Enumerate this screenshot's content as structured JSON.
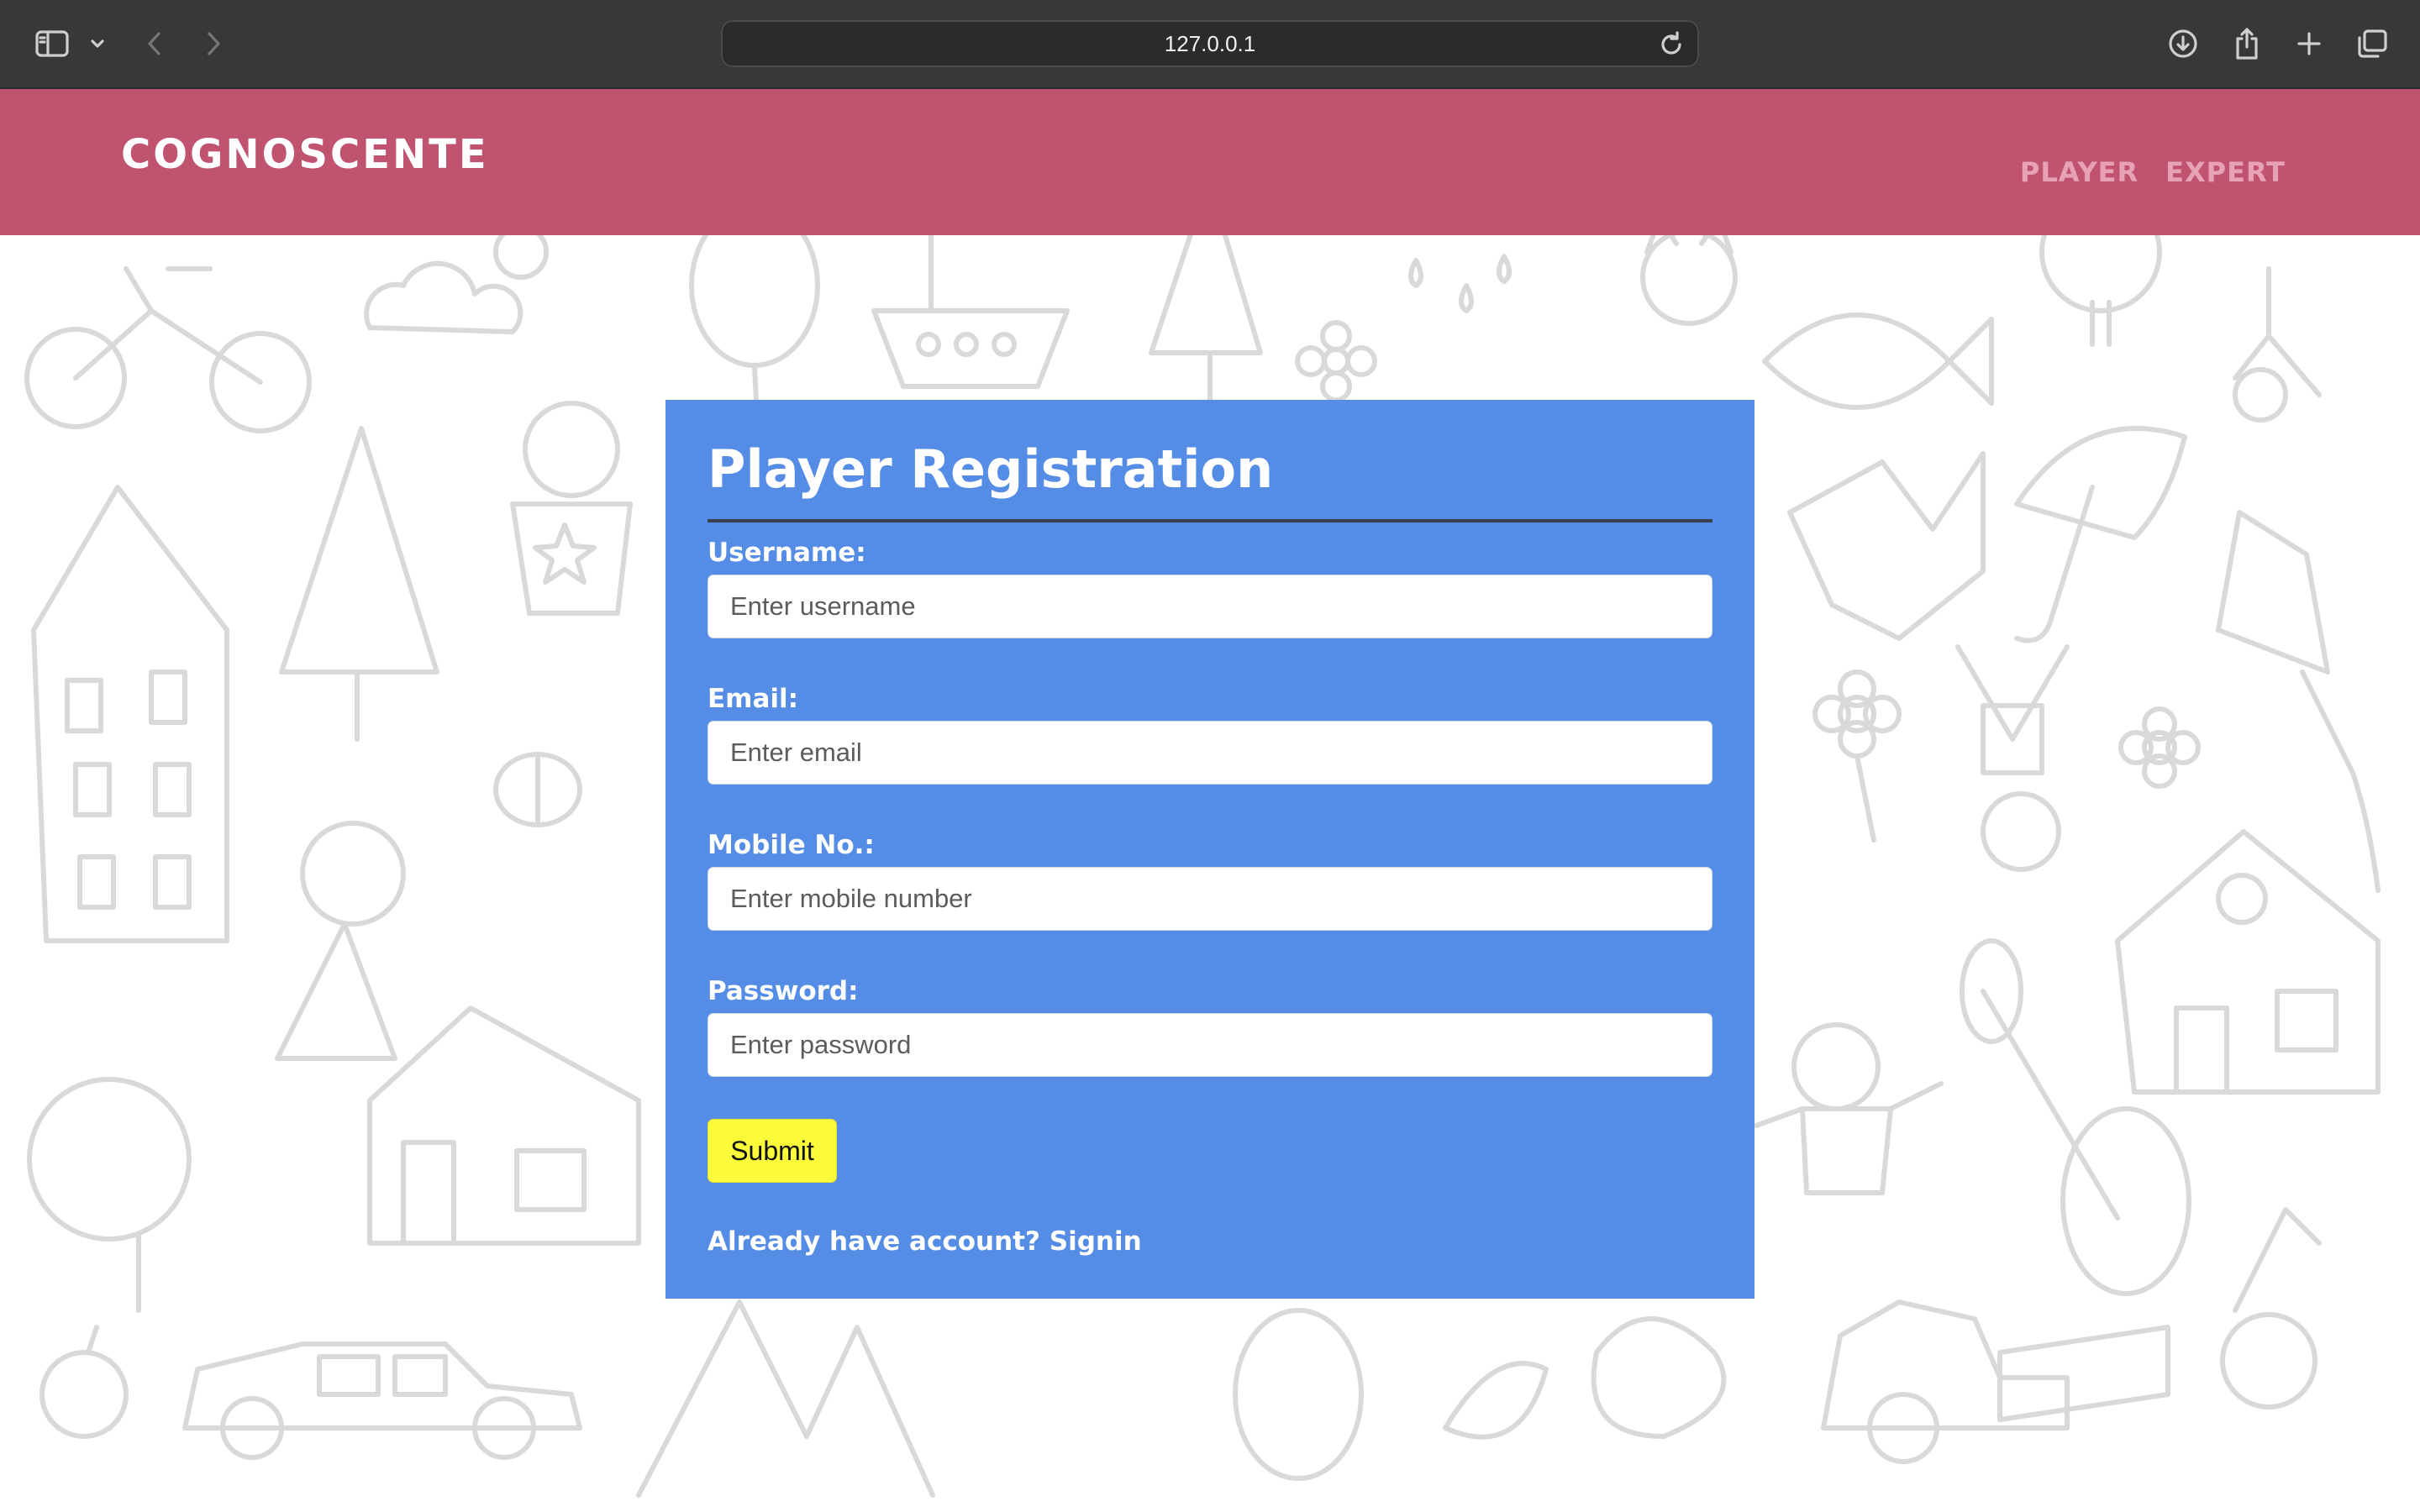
{
  "browser": {
    "url": "127.0.0.1"
  },
  "site": {
    "brand": "COGNOSCENTE",
    "nav": [
      {
        "label": "PLAYER"
      },
      {
        "label": "EXPERT"
      }
    ]
  },
  "form": {
    "title": "Player Registration",
    "fields": {
      "username": {
        "label": "Username:",
        "placeholder": "Enter username"
      },
      "email": {
        "label": "Email:",
        "placeholder": "Enter email"
      },
      "mobile": {
        "label": "Mobile No.:",
        "placeholder": "Enter mobile number"
      },
      "password": {
        "label": "Password:",
        "placeholder": "Enter password"
      }
    },
    "submit_label": "Submit",
    "signin_link": "Already have account? Signin"
  },
  "colors": {
    "header": "#c05470",
    "card": "#548ce6",
    "submit": "#fbfb3c",
    "nav_link": "#e7a3b5"
  }
}
